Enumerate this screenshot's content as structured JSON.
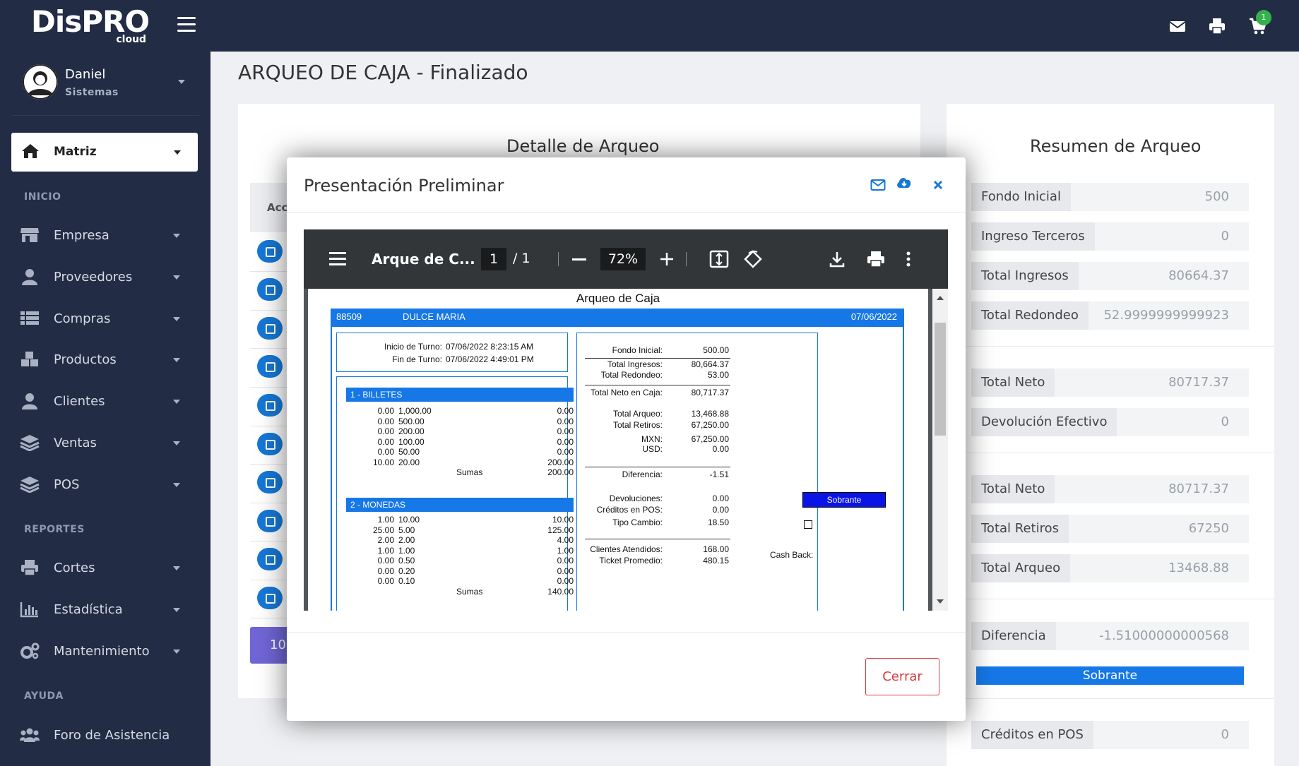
{
  "topbar": {
    "logo_main": "DisPRO",
    "logo_sub": "cloud",
    "cart_count": "1"
  },
  "sidebar": {
    "user_name": "Daniel",
    "user_role": "Sistemas",
    "branch": "Matriz",
    "sections": {
      "inicio": "INICIO",
      "reportes": "REPORTES",
      "ayuda": "AYUDA"
    },
    "items": [
      {
        "label": "Empresa",
        "icon": "store-icon"
      },
      {
        "label": "Proveedores",
        "icon": "user-icon"
      },
      {
        "label": "Compras",
        "icon": "list-icon"
      },
      {
        "label": "Productos",
        "icon": "boxes-icon"
      },
      {
        "label": "Clientes",
        "icon": "user-icon"
      },
      {
        "label": "Ventas",
        "icon": "layers-icon"
      },
      {
        "label": "POS",
        "icon": "layers-icon"
      },
      {
        "label": "Cortes",
        "icon": "print-icon"
      },
      {
        "label": "Estadística",
        "icon": "bar-chart-icon"
      },
      {
        "label": "Mantenimiento",
        "icon": "gears-icon"
      },
      {
        "label": "Foro de Asistencia",
        "icon": "users-icon"
      }
    ]
  },
  "page": {
    "title": "ARQUEO DE CAJA - Finalizado",
    "detalle_title": "Detalle de Arqueo",
    "table_head": "Acc",
    "pagination_button": "10"
  },
  "resumen": {
    "title": "Resumen de Arqueo",
    "rows": [
      {
        "label": "Fondo Inicial",
        "value": "500"
      },
      {
        "label": "Ingreso Terceros",
        "value": "0"
      },
      {
        "label": "Total Ingresos",
        "value": "80664.37"
      },
      {
        "label": "Total Redondeo",
        "value": "52.9999999999923"
      },
      {
        "label": "Total Neto",
        "value": "80717.37"
      },
      {
        "label": "Devolución Efectivo",
        "value": "0"
      },
      {
        "label": "Total Neto",
        "value": "80717.37"
      },
      {
        "label": "Total Retiros",
        "value": "67250"
      },
      {
        "label": "Total Arqueo",
        "value": "13468.88"
      },
      {
        "label": "Diferencia",
        "value": "-1.51000000000568"
      },
      {
        "label": "Créditos en POS",
        "value": "0"
      }
    ],
    "status": "Sobrante"
  },
  "modal": {
    "title": "Presentación Preliminar",
    "close_button": "Cerrar",
    "viewer": {
      "doc_title": "Arque de C...",
      "page_current": "1",
      "page_total": "/ 1",
      "zoom": "72%"
    }
  },
  "report": {
    "title": "Arqueo de Caja",
    "id": "88509",
    "cashier": "DULCE MARIA",
    "date": "07/06/2022",
    "shift_start_label": "Inicio de Turno:",
    "shift_start": "07/06/2022  8:23:15 AM",
    "shift_end_label": "Fin de Turno:",
    "shift_end": "07/06/2022  4:49:01 PM",
    "billetes_title": "1 - BILLETES",
    "billetes": [
      {
        "qty": "0.00",
        "denom": "1,000.00",
        "total": "0.00"
      },
      {
        "qty": "0.00",
        "denom": "500.00",
        "total": "0.00"
      },
      {
        "qty": "0.00",
        "denom": "200.00",
        "total": "0.00"
      },
      {
        "qty": "0.00",
        "denom": "100.00",
        "total": "0.00"
      },
      {
        "qty": "0.00",
        "denom": "50.00",
        "total": "0.00"
      },
      {
        "qty": "10.00",
        "denom": "20.00",
        "total": "200.00"
      }
    ],
    "billetes_sum_label": "Sumas",
    "billetes_sum": "200.00",
    "monedas_title": "2 - MONEDAS",
    "monedas": [
      {
        "qty": "1.00",
        "denom": "10.00",
        "total": "10.00"
      },
      {
        "qty": "25.00",
        "denom": "5.00",
        "total": "125.00"
      },
      {
        "qty": "2.00",
        "denom": "2.00",
        "total": "4.00"
      },
      {
        "qty": "1.00",
        "denom": "1.00",
        "total": "1.00"
      },
      {
        "qty": "0.00",
        "denom": "0.50",
        "total": "0.00"
      },
      {
        "qty": "0.00",
        "denom": "0.20",
        "total": "0.00"
      },
      {
        "qty": "0.00",
        "denom": "0.10",
        "total": "0.00"
      }
    ],
    "monedas_sum_label": "Sumas",
    "monedas_sum": "140.00",
    "right": [
      {
        "label": "Fondo Inicial:",
        "value": "500.00"
      },
      {
        "label": "Total Ingresos:",
        "value": "80,664.37"
      },
      {
        "label": "Total Redondeo:",
        "value": "53.00"
      },
      {
        "label": "Total Neto en Caja:",
        "value": "80,717.37"
      },
      {
        "label": "Total Arqueo:",
        "value": "13,468.88"
      },
      {
        "label": "Total Retiros:",
        "value": "67,250.00"
      },
      {
        "label": "MXN:",
        "value": "67,250.00"
      },
      {
        "label": "USD:",
        "value": "0.00"
      },
      {
        "label": "Diferencia:",
        "value": "-1.51"
      },
      {
        "label": "Devoluciones:",
        "value": "0.00"
      },
      {
        "label": "Créditos en POS:",
        "value": "0.00"
      },
      {
        "label": "Tipo Cambio:",
        "value": "18.50"
      },
      {
        "label": "Clientes Atendidos:",
        "value": "168.00"
      },
      {
        "label": "Ticket Promedio:",
        "value": "480.15"
      }
    ],
    "sobrante": "Sobrante",
    "cash_back_label": "Cash Back:"
  }
}
